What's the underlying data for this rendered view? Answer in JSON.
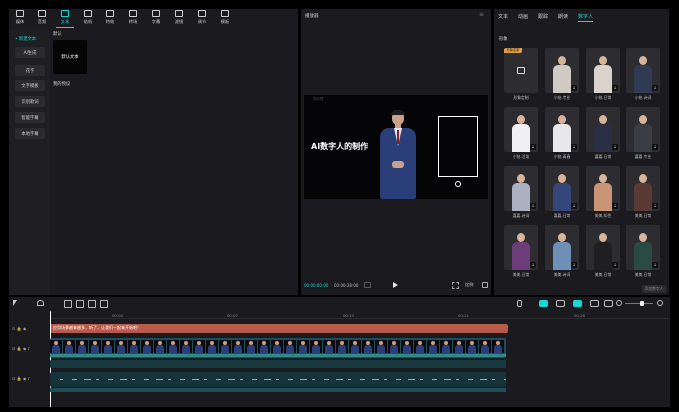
{
  "toolbar": {
    "items": [
      {
        "label": "媒体",
        "icon": "media-icon"
      },
      {
        "label": "音频",
        "icon": "audio-icon"
      },
      {
        "label": "文本",
        "icon": "text-icon"
      },
      {
        "label": "贴纸",
        "icon": "sticker-icon"
      },
      {
        "label": "特效",
        "icon": "effects-icon"
      },
      {
        "label": "转场",
        "icon": "transition-icon"
      },
      {
        "label": "字幕",
        "icon": "caption-icon"
      },
      {
        "label": "滤镜",
        "icon": "filter-icon"
      },
      {
        "label": "调节",
        "icon": "adjust-icon"
      },
      {
        "label": "模板",
        "icon": "template-icon"
      }
    ],
    "active_index": 2
  },
  "sidebar": {
    "items": [
      "• 新建文本",
      "AI生成",
      "花字",
      "文字模板",
      "识别歌词",
      "智能字幕",
      "本地字幕"
    ]
  },
  "text_library": {
    "section_default": "默认",
    "default_card": "默认文本",
    "section_presets": "我的预设"
  },
  "player": {
    "title": "播放器",
    "menu_icon": "≡",
    "watermark": "内示性",
    "video_title": "AI数字人的制作",
    "time_current": "00:00:00:00",
    "time_total": "00:00:28:00",
    "ratio_label": "比例",
    "accent": "#1ad6d6"
  },
  "right_panel": {
    "tabs": [
      "文本",
      "动画",
      "跟踪",
      "朗读",
      "数字人"
    ],
    "active_tab": 4,
    "section": "形象",
    "badge": "形象定制",
    "avatars": [
      {
        "label": "形象定制",
        "suit": "#3a3a40"
      },
      {
        "label": "小铭-专业",
        "suit": "#cfcac4"
      },
      {
        "label": "小铭-日常",
        "suit": "#d9d3cb"
      },
      {
        "label": "小铭-诗词",
        "suit": "#2f3a55"
      },
      {
        "label": "小铭-活泼",
        "suit": "#f0f0f2"
      },
      {
        "label": "小铭-青春",
        "suit": "#e8e8ea"
      },
      {
        "label": "嘉嘉-日常",
        "suit": "#2a2f45"
      },
      {
        "label": "嘉嘉-专业",
        "suit": "#3a3d44"
      },
      {
        "label": "嘉嘉-诗词",
        "suit": "#aab2c2"
      },
      {
        "label": "嘉嘉-日常",
        "suit": "#35477a"
      },
      {
        "label": "美美-知性",
        "suit": "#c99576"
      },
      {
        "label": "美美-日常",
        "suit": "#5a3a34"
      },
      {
        "label": "美美-日常",
        "suit": "#6d3d7a"
      },
      {
        "label": "美美-诗词",
        "suit": "#6e8fb8"
      },
      {
        "label": "美美-日常",
        "suit": "#1f1f22"
      },
      {
        "label": "美美-日常",
        "suit": "#2c4a44"
      }
    ],
    "add_button": "添加数字人"
  },
  "timeline": {
    "ruler": [
      "00:00",
      "00:07",
      "00:14",
      "00:21",
      "00:28"
    ],
    "text_clip": "应用场景越来越多，听了，让我们一起来开始吧！",
    "zoom_fraction": 0.6
  }
}
